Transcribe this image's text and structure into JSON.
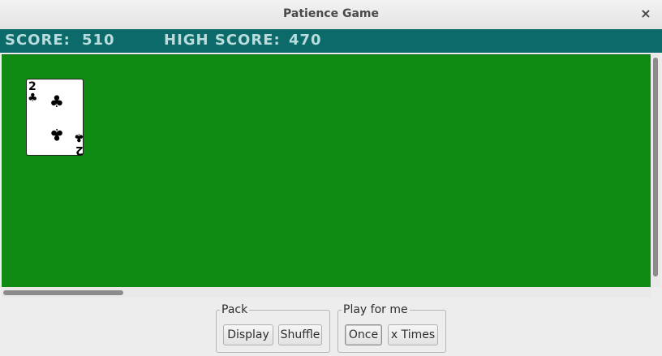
{
  "window": {
    "title": "Patience Game",
    "close_glyph": "×"
  },
  "scorebar": {
    "score_label": "SCORE:",
    "score_value": "510",
    "high_label": "HIGH SCORE:",
    "high_value": "470"
  },
  "card": {
    "rank": "2",
    "suit_icon": "club-icon",
    "suit_glyph": "♣"
  },
  "pack_panel": {
    "legend": "Pack",
    "buttons": [
      "Display",
      "Shuffle"
    ]
  },
  "play_panel": {
    "legend": "Play for me",
    "buttons": [
      "Once",
      "x Times"
    ]
  },
  "colors": {
    "table": "#0f8a12",
    "scorebar": "#0c6a6a",
    "score_text": "#b9dcdc"
  }
}
